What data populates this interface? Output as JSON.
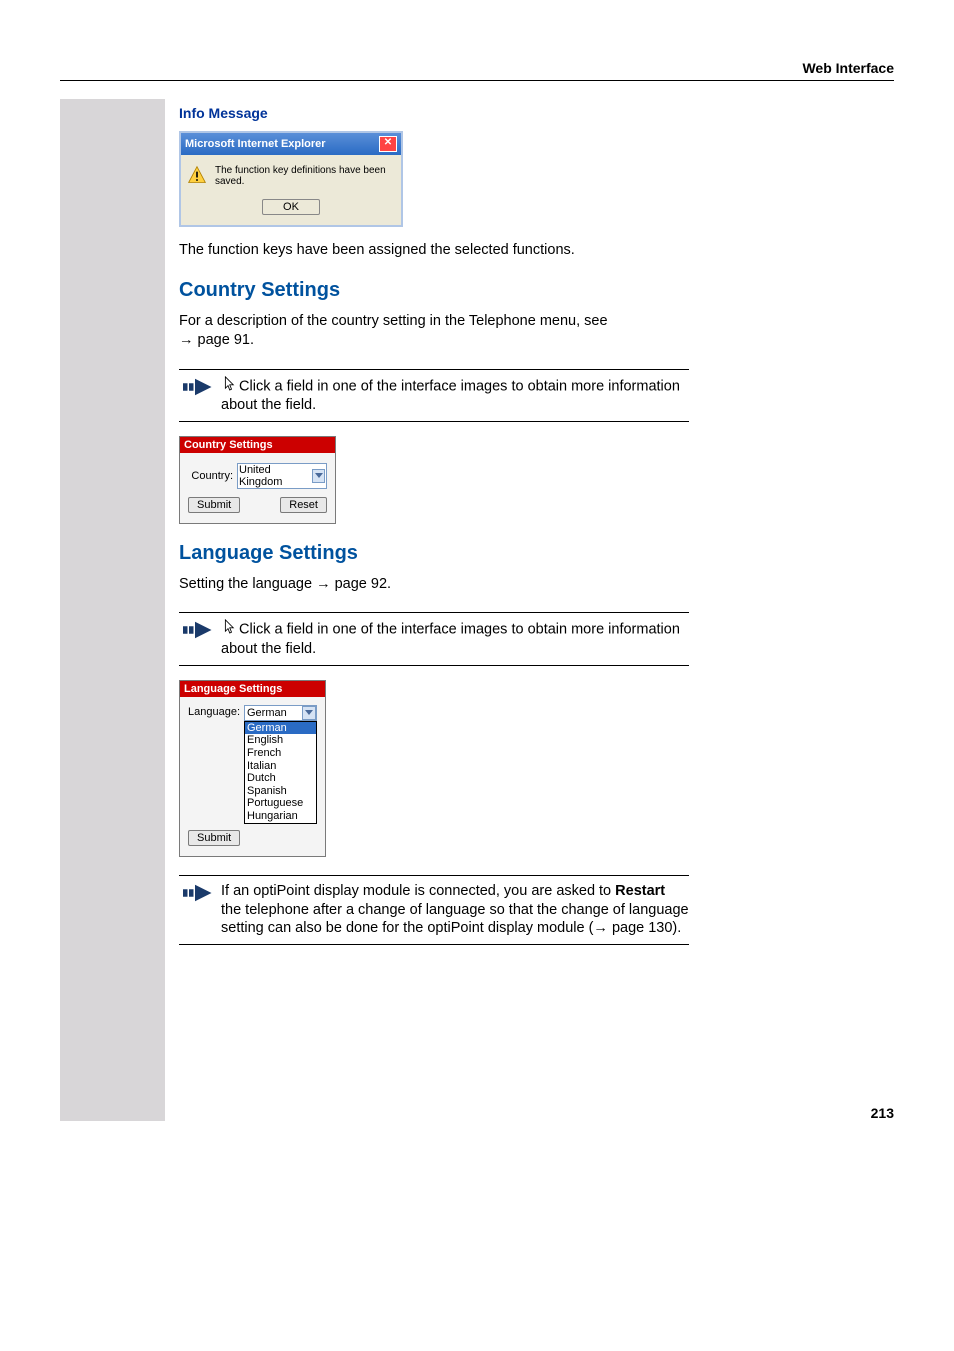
{
  "header": {
    "title": "Web Interface"
  },
  "info_message": {
    "heading": "Info Message",
    "dialog": {
      "title": "Microsoft Internet Explorer",
      "body": "The function key definitions have been saved.",
      "ok": "OK"
    },
    "after_text": "The function keys have been assigned the selected functions."
  },
  "country": {
    "heading": "Country Settings",
    "desc_prefix": "For a description of the country setting in the Telephone menu, see ",
    "desc_link": "page 91",
    "note": "Click a field in one of the interface images to obtain more information about the field.",
    "panel": {
      "title": "Country Settings",
      "label": "Country:",
      "value": "United Kingdom",
      "submit": "Submit",
      "reset": "Reset"
    }
  },
  "language": {
    "heading": "Language Settings",
    "desc_prefix": "Setting the language ",
    "desc_link": "page 92",
    "note": "Click a field in one of the interface images to obtain more information about the field.",
    "panel": {
      "title": "Language Settings",
      "label": "Language:",
      "selected": "German",
      "options": [
        "German",
        "English",
        "French",
        "Italian",
        "Dutch",
        "Spanish",
        "Portuguese",
        "Hungarian"
      ],
      "submit": "Submit"
    },
    "restart_note_1": "If an optiPoint display module is connected, you are asked to ",
    "restart_bold": "Restart",
    "restart_note_2": " the telephone after a change of language so that the change of language setting can also be done for the optiPoint display module (",
    "restart_link": "page 130",
    "restart_note_3": ")."
  },
  "page_number": "213"
}
